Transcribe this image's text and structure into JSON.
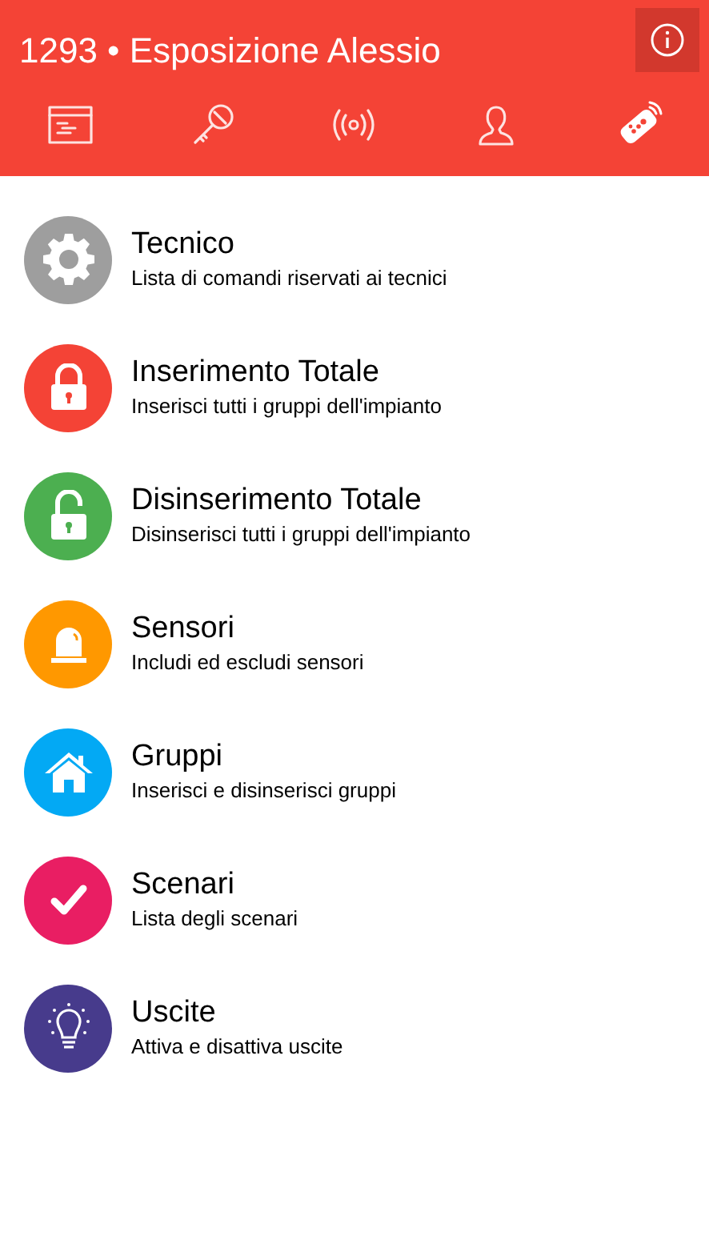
{
  "header": {
    "title": "1293 • Esposizione Alessio"
  },
  "tabs": [
    {
      "kind": "panel",
      "selected": false
    },
    {
      "kind": "key",
      "selected": false
    },
    {
      "kind": "signal",
      "selected": false
    },
    {
      "kind": "user",
      "selected": false
    },
    {
      "kind": "remote",
      "selected": true
    }
  ],
  "menu": [
    {
      "kind": "gear",
      "color": "#9e9e9e",
      "title": "Tecnico",
      "subtitle": "Lista di comandi riservati ai tecnici"
    },
    {
      "kind": "lock",
      "color": "#f44336",
      "title": "Inserimento Totale",
      "subtitle": "Inserisci tutti i gruppi dell'impianto"
    },
    {
      "kind": "unlock",
      "color": "#4caf50",
      "title": "Disinserimento Totale",
      "subtitle": "Disinserisci tutti i gruppi dell'impianto"
    },
    {
      "kind": "siren",
      "color": "#ff9800",
      "title": "Sensori",
      "subtitle": "Includi ed escludi sensori"
    },
    {
      "kind": "house",
      "color": "#03a9f4",
      "title": "Gruppi",
      "subtitle": "Inserisci e disinserisci gruppi"
    },
    {
      "kind": "check",
      "color": "#e91e63",
      "title": "Scenari",
      "subtitle": "Lista degli scenari"
    },
    {
      "kind": "bulb",
      "color": "#473b8c",
      "title": "Uscite",
      "subtitle": "Attiva e disattiva uscite"
    }
  ]
}
